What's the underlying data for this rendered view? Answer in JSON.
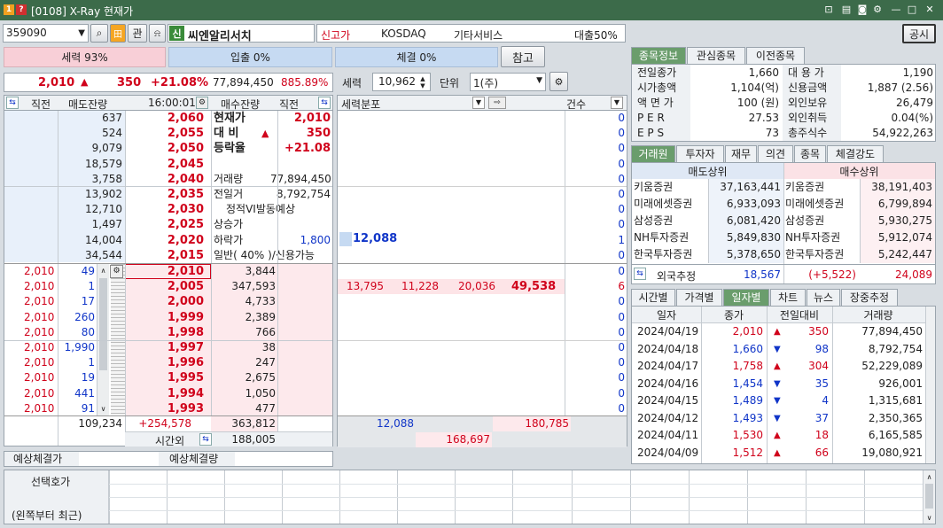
{
  "window": {
    "title": "[0108] X-Ray 현재가",
    "close_label": "공시"
  },
  "toolbar": {
    "code": "359090",
    "gwan": "관",
    "shin": "신",
    "name": "씨엔알리서치",
    "high_label": "신고가",
    "market": "KOSDAQ",
    "sector": "기타서비스",
    "loan": "대출50%"
  },
  "strength": {
    "seryeok": "세력 93%",
    "ipchul": "입출 0%",
    "chegyeol": "체결 0%",
    "ref_button": "참고"
  },
  "price_line": {
    "price": "2,010",
    "arrow": "▲",
    "change": "350",
    "rate": "+21.08%",
    "volume": "77,894,450",
    "ratio": "885.89%"
  },
  "order_header": {
    "col1": "직전",
    "col2": "매도잔량",
    "time": "16:00:01",
    "col4": "매수잔량",
    "col5": "직전"
  },
  "ask_rows": [
    {
      "qty": "637",
      "price": "2,060"
    },
    {
      "qty": "524",
      "price": "2,055"
    },
    {
      "qty": "9,079",
      "price": "2,050"
    },
    {
      "qty": "18,579",
      "price": "2,045"
    },
    {
      "qty": "3,758",
      "price": "2,040"
    },
    {
      "qty": "13,902",
      "price": "2,035"
    },
    {
      "qty": "12,710",
      "price": "2,030"
    },
    {
      "qty": "1,497",
      "price": "2,025"
    },
    {
      "qty": "14,004",
      "price": "2,020"
    },
    {
      "qty": "34,544",
      "price": "2,015"
    }
  ],
  "info_rows": [
    {
      "label": "현재가",
      "value": "2,010",
      "bold": true,
      "red": true
    },
    {
      "label": "대 비",
      "arrow": "▲",
      "value": "350",
      "bold": true,
      "red": true
    },
    {
      "label": "등락율",
      "value": "+21.08",
      "bold": true,
      "red": true
    },
    {
      "label": "",
      "value": ""
    },
    {
      "label": "거래량",
      "value": "77,894,450"
    },
    {
      "label": "전일거",
      "value": "8,792,754"
    },
    {
      "label": "정적VI발동예상",
      "value": ""
    },
    {
      "label": "상승가",
      "value": ""
    },
    {
      "label": "하락가",
      "value": "1,800",
      "blue": true
    },
    {
      "label": "일반( 40% )/신용가능",
      "value": ""
    }
  ],
  "bid_rows": [
    {
      "prev": "2,010",
      "prevqty": "49",
      "price": "2,010",
      "qty": "3,844"
    },
    {
      "prev": "2,010",
      "prevqty": "1",
      "price": "2,005",
      "qty": "347,593"
    },
    {
      "prev": "2,010",
      "prevqty": "17",
      "price": "2,000",
      "qty": "4,733"
    },
    {
      "prev": "2,010",
      "prevqty": "260",
      "price": "1,999",
      "qty": "2,389"
    },
    {
      "prev": "2,010",
      "prevqty": "80",
      "price": "1,998",
      "qty": "766"
    },
    {
      "prev": "2,010",
      "prevqty": "1,990",
      "price": "1,997",
      "qty": "38"
    },
    {
      "prev": "2,010",
      "prevqty": "1",
      "price": "1,996",
      "qty": "247"
    },
    {
      "prev": "2,010",
      "prevqty": "19",
      "price": "1,995",
      "qty": "2,675"
    },
    {
      "prev": "2,010",
      "prevqty": "441",
      "price": "1,994",
      "qty": "1,050"
    },
    {
      "prev": "2,010",
      "prevqty": "91",
      "price": "1,993",
      "qty": "477"
    }
  ],
  "totals": {
    "ask_total": "109,234",
    "diff": "+254,578",
    "bid_total": "363,812",
    "after_label": "시간외",
    "after_value": "188,005"
  },
  "expected": {
    "label1": "예상체결가",
    "label2": "예상체결량"
  },
  "seryeok_panel": {
    "label": "세력",
    "value": "10,962",
    "unit_label": "단위",
    "unit_value": "1(주)",
    "dist_label": "세력분포",
    "count_label": "건수",
    "ask_counts": [
      "0",
      "0",
      "0",
      "0",
      "0",
      "0",
      "0",
      "0",
      "1",
      "0"
    ],
    "bid_counts": [
      "0",
      "6",
      "0",
      "0",
      "0",
      "0",
      "0",
      "0",
      "0",
      "0"
    ],
    "ask_dist_value": "12,088",
    "bid_dist_values": [
      "13,795",
      "11,228",
      "20,036",
      "49,538"
    ],
    "footer_ask": "12,088",
    "footer_bid": "180,785",
    "footer_total": "168,697"
  },
  "stock_info": {
    "tabs": [
      "종목정보",
      "관심종목",
      "이전종목"
    ],
    "rows": [
      {
        "l1": "전일종가",
        "v1": "1,660",
        "l2": "대 용 가",
        "v2": "1,190"
      },
      {
        "l1": "시가총액",
        "v1": "1,104(억)",
        "l2": "신용금액",
        "v2": "1,887  (2.56)"
      },
      {
        "l1": "액 면 가",
        "v1": "100 (원)",
        "l2": "외인보유",
        "v2": "26,479"
      },
      {
        "l1": "P E R",
        "v1": "27.53",
        "l2": "외인취득",
        "v2": "0.04(%)"
      },
      {
        "l1": "E P S",
        "v1": "73",
        "l2": "총주식수",
        "v2": "54,922,263"
      }
    ]
  },
  "broker": {
    "tabs": [
      "거래원",
      "투자자",
      "재무",
      "의견",
      "종목",
      "체결강도"
    ],
    "sell_header": "매도상위",
    "buy_header": "매수상위",
    "rows": [
      {
        "sname": "키움증권",
        "sval": "37,163,441",
        "bname": "키움증권",
        "bval": "38,191,403"
      },
      {
        "sname": "미래에셋증권",
        "sval": "6,933,093",
        "bname": "미래에셋증권",
        "bval": "6,799,894"
      },
      {
        "sname": "삼성증권",
        "sval": "6,081,420",
        "bname": "삼성증권",
        "bval": "5,930,275"
      },
      {
        "sname": "NH투자증권",
        "sval": "5,849,830",
        "bname": "NH투자증권",
        "bval": "5,912,074"
      },
      {
        "sname": "한국투자증권",
        "sval": "5,378,650",
        "bname": "한국투자증권",
        "bval": "5,242,447"
      }
    ],
    "foreign_label": "외국추정",
    "foreign_sell": "18,567",
    "foreign_diff": "(+5,522)",
    "foreign_buy": "24,089"
  },
  "daily": {
    "tabs": [
      "시간별",
      "가격별",
      "일자별",
      "차트",
      "뉴스",
      "장중추정"
    ],
    "headers": [
      "일자",
      "종가",
      "전일대비",
      "거래량"
    ],
    "rows": [
      {
        "date": "2024/04/19",
        "close": "2,010",
        "dir": "up",
        "arrow": "▲",
        "chg": "350",
        "vol": "77,894,450"
      },
      {
        "date": "2024/04/18",
        "close": "1,660",
        "dir": "down",
        "arrow": "▼",
        "chg": "98",
        "vol": "8,792,754"
      },
      {
        "date": "2024/04/17",
        "close": "1,758",
        "dir": "up",
        "arrow": "▲",
        "chg": "304",
        "vol": "52,229,089"
      },
      {
        "date": "2024/04/16",
        "close": "1,454",
        "dir": "down",
        "arrow": "▼",
        "chg": "35",
        "vol": "926,001"
      },
      {
        "date": "2024/04/15",
        "close": "1,489",
        "dir": "down",
        "arrow": "▼",
        "chg": "4",
        "vol": "1,315,681"
      },
      {
        "date": "2024/04/12",
        "close": "1,493",
        "dir": "down",
        "arrow": "▼",
        "chg": "37",
        "vol": "2,350,365"
      },
      {
        "date": "2024/04/11",
        "close": "1,530",
        "dir": "up",
        "arrow": "▲",
        "chg": "18",
        "vol": "6,165,585"
      },
      {
        "date": "2024/04/09",
        "close": "1,512",
        "dir": "up",
        "arrow": "▲",
        "chg": "66",
        "vol": "19,080,921"
      }
    ]
  },
  "bottom": {
    "label1": "선택호가",
    "label2": "(왼쪽부터 최근)"
  }
}
